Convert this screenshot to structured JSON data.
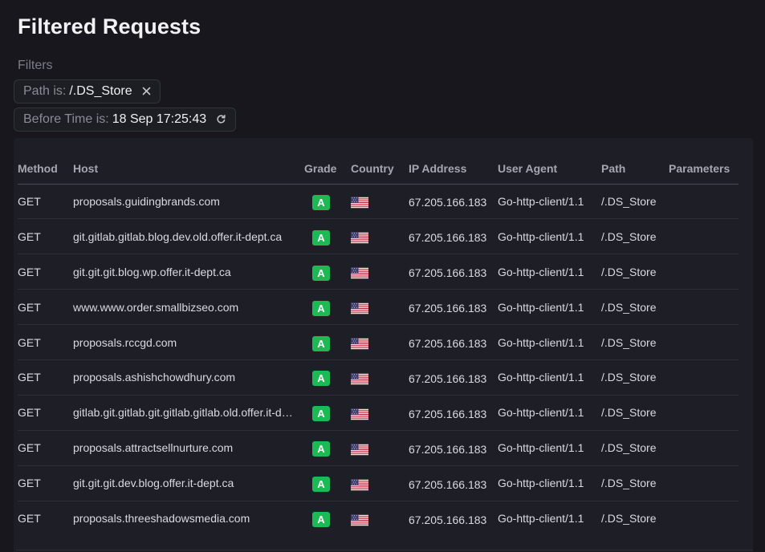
{
  "page": {
    "title": "Filtered Requests"
  },
  "filters": {
    "label": "Filters",
    "chips": [
      {
        "key": "Path is:",
        "value": "/.DS_Store",
        "action_icon": "close-icon"
      },
      {
        "key": "Before Time is:",
        "value": "18 Sep 17:25:43",
        "action_icon": "refresh-icon"
      }
    ]
  },
  "table": {
    "headers": [
      "Method",
      "Host",
      "Grade",
      "Country",
      "IP Address",
      "User Agent",
      "Path",
      "Parameters"
    ],
    "rows": [
      {
        "method": "GET",
        "host": "proposals.guidingbrands.com",
        "grade": "A",
        "country_icon": "us-flag-icon",
        "ip": "67.205.166.183",
        "user_agent": "Go-http-client/1.1",
        "path": "/.DS_Store",
        "parameters": ""
      },
      {
        "method": "GET",
        "host": "git.gitlab.gitlab.blog.dev.old.offer.it-dept.ca",
        "grade": "A",
        "country_icon": "us-flag-icon",
        "ip": "67.205.166.183",
        "user_agent": "Go-http-client/1.1",
        "path": "/.DS_Store",
        "parameters": ""
      },
      {
        "method": "GET",
        "host": "git.git.git.blog.wp.offer.it-dept.ca",
        "grade": "A",
        "country_icon": "us-flag-icon",
        "ip": "67.205.166.183",
        "user_agent": "Go-http-client/1.1",
        "path": "/.DS_Store",
        "parameters": ""
      },
      {
        "method": "GET",
        "host": "www.www.order.smallbizseo.com",
        "grade": "A",
        "country_icon": "us-flag-icon",
        "ip": "67.205.166.183",
        "user_agent": "Go-http-client/1.1",
        "path": "/.DS_Store",
        "parameters": ""
      },
      {
        "method": "GET",
        "host": "proposals.rccgd.com",
        "grade": "A",
        "country_icon": "us-flag-icon",
        "ip": "67.205.166.183",
        "user_agent": "Go-http-client/1.1",
        "path": "/.DS_Store",
        "parameters": ""
      },
      {
        "method": "GET",
        "host": "proposals.ashishchowdhury.com",
        "grade": "A",
        "country_icon": "us-flag-icon",
        "ip": "67.205.166.183",
        "user_agent": "Go-http-client/1.1",
        "path": "/.DS_Store",
        "parameters": ""
      },
      {
        "method": "GET",
        "host": "gitlab.git.gitlab.git.gitlab.gitlab.old.offer.it-dept.ca",
        "grade": "A",
        "country_icon": "us-flag-icon",
        "ip": "67.205.166.183",
        "user_agent": "Go-http-client/1.1",
        "path": "/.DS_Store",
        "parameters": ""
      },
      {
        "method": "GET",
        "host": "proposals.attractsellnurture.com",
        "grade": "A",
        "country_icon": "us-flag-icon",
        "ip": "67.205.166.183",
        "user_agent": "Go-http-client/1.1",
        "path": "/.DS_Store",
        "parameters": ""
      },
      {
        "method": "GET",
        "host": "git.git.git.dev.blog.offer.it-dept.ca",
        "grade": "A",
        "country_icon": "us-flag-icon",
        "ip": "67.205.166.183",
        "user_agent": "Go-http-client/1.1",
        "path": "/.DS_Store",
        "parameters": ""
      },
      {
        "method": "GET",
        "host": "proposals.threeshadowsmedia.com",
        "grade": "A",
        "country_icon": "us-flag-icon",
        "ip": "67.205.166.183",
        "user_agent": "Go-http-client/1.1",
        "path": "/.DS_Store",
        "parameters": ""
      }
    ]
  },
  "colors": {
    "background": "#17171d",
    "panel": "#1e1e26",
    "grade_a": "#1db954"
  }
}
